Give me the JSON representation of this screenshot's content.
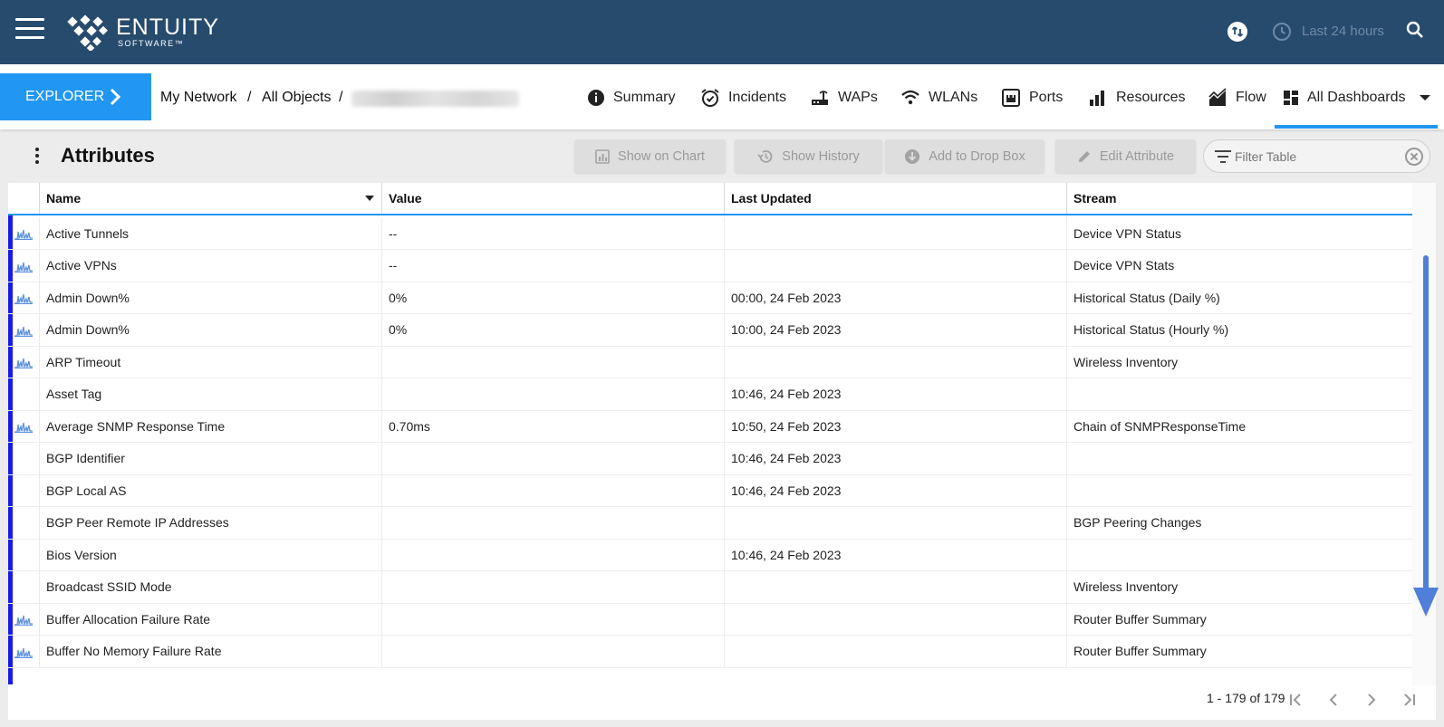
{
  "header": {
    "brand_name": "ENTUITY",
    "brand_sub": "SOFTWARE™",
    "time_range": "Last 24 hours"
  },
  "nav": {
    "explorer_label": "EXPLORER",
    "breadcrumb": [
      "My Network",
      "All Objects"
    ],
    "separator": "/",
    "tabs": [
      {
        "label": "Summary",
        "icon": "info-icon"
      },
      {
        "label": "Incidents",
        "icon": "alarm-icon"
      },
      {
        "label": "WAPs",
        "icon": "router-icon"
      },
      {
        "label": "WLANs",
        "icon": "wifi-icon"
      },
      {
        "label": "Ports",
        "icon": "ethernet-port-icon"
      },
      {
        "label": "Resources",
        "icon": "bar-chart-icon"
      },
      {
        "label": "Flow",
        "icon": "area-chart-icon"
      },
      {
        "label": "All Dashboards",
        "icon": "dashboard-icon"
      }
    ]
  },
  "panel": {
    "title": "Attributes",
    "buttons": {
      "show_on_chart": "Show on Chart",
      "show_history": "Show History",
      "add_to_drop_box": "Add to Drop Box",
      "edit_attribute": "Edit Attribute"
    },
    "filter_placeholder": "Filter Table"
  },
  "table": {
    "columns": [
      "Name",
      "Value",
      "Last Updated",
      "Stream"
    ],
    "rows": [
      {
        "chart": true,
        "name": "Active Tunnels",
        "value": "--",
        "updated": "",
        "stream": "Device VPN Status"
      },
      {
        "chart": true,
        "name": "Active VPNs",
        "value": "--",
        "updated": "",
        "stream": "Device VPN Stats"
      },
      {
        "chart": true,
        "name": "Admin Down%",
        "value": "0%",
        "updated": "00:00, 24 Feb 2023",
        "stream": "Historical Status (Daily %)"
      },
      {
        "chart": true,
        "name": "Admin Down%",
        "value": "0%",
        "updated": "10:00, 24 Feb 2023",
        "stream": "Historical Status (Hourly %)"
      },
      {
        "chart": true,
        "name": "ARP Timeout",
        "value": "",
        "updated": "",
        "stream": "Wireless Inventory"
      },
      {
        "chart": false,
        "name": "Asset Tag",
        "value": "",
        "updated": "10:46, 24 Feb 2023",
        "stream": ""
      },
      {
        "chart": true,
        "name": "Average SNMP Response Time",
        "value": "0.70ms",
        "updated": "10:50, 24 Feb 2023",
        "stream": "Chain of SNMPResponseTime"
      },
      {
        "chart": false,
        "name": "BGP Identifier",
        "value": "",
        "updated": "10:46, 24 Feb 2023",
        "stream": ""
      },
      {
        "chart": false,
        "name": "BGP Local AS",
        "value": "",
        "updated": "10:46, 24 Feb 2023",
        "stream": ""
      },
      {
        "chart": false,
        "name": "BGP Peer Remote IP Addresses",
        "value": "",
        "updated": "",
        "stream": "BGP Peering Changes"
      },
      {
        "chart": false,
        "name": "Bios Version",
        "value": "",
        "updated": "10:46, 24 Feb 2023",
        "stream": ""
      },
      {
        "chart": false,
        "name": "Broadcast SSID Mode",
        "value": "",
        "updated": "",
        "stream": "Wireless Inventory"
      },
      {
        "chart": true,
        "name": "Buffer Allocation Failure Rate",
        "value": "",
        "updated": "",
        "stream": "Router Buffer Summary"
      },
      {
        "chart": true,
        "name": "Buffer No Memory Failure Rate",
        "value": "",
        "updated": "",
        "stream": "Router Buffer Summary"
      }
    ]
  },
  "pager": {
    "range_text": "1 - 179 of 179"
  },
  "colors": {
    "header_bg": "#274b6d",
    "accent": "#2196f3",
    "row_marker": "#1a1ae6",
    "annotation_arrow": "#4f7fd8"
  }
}
